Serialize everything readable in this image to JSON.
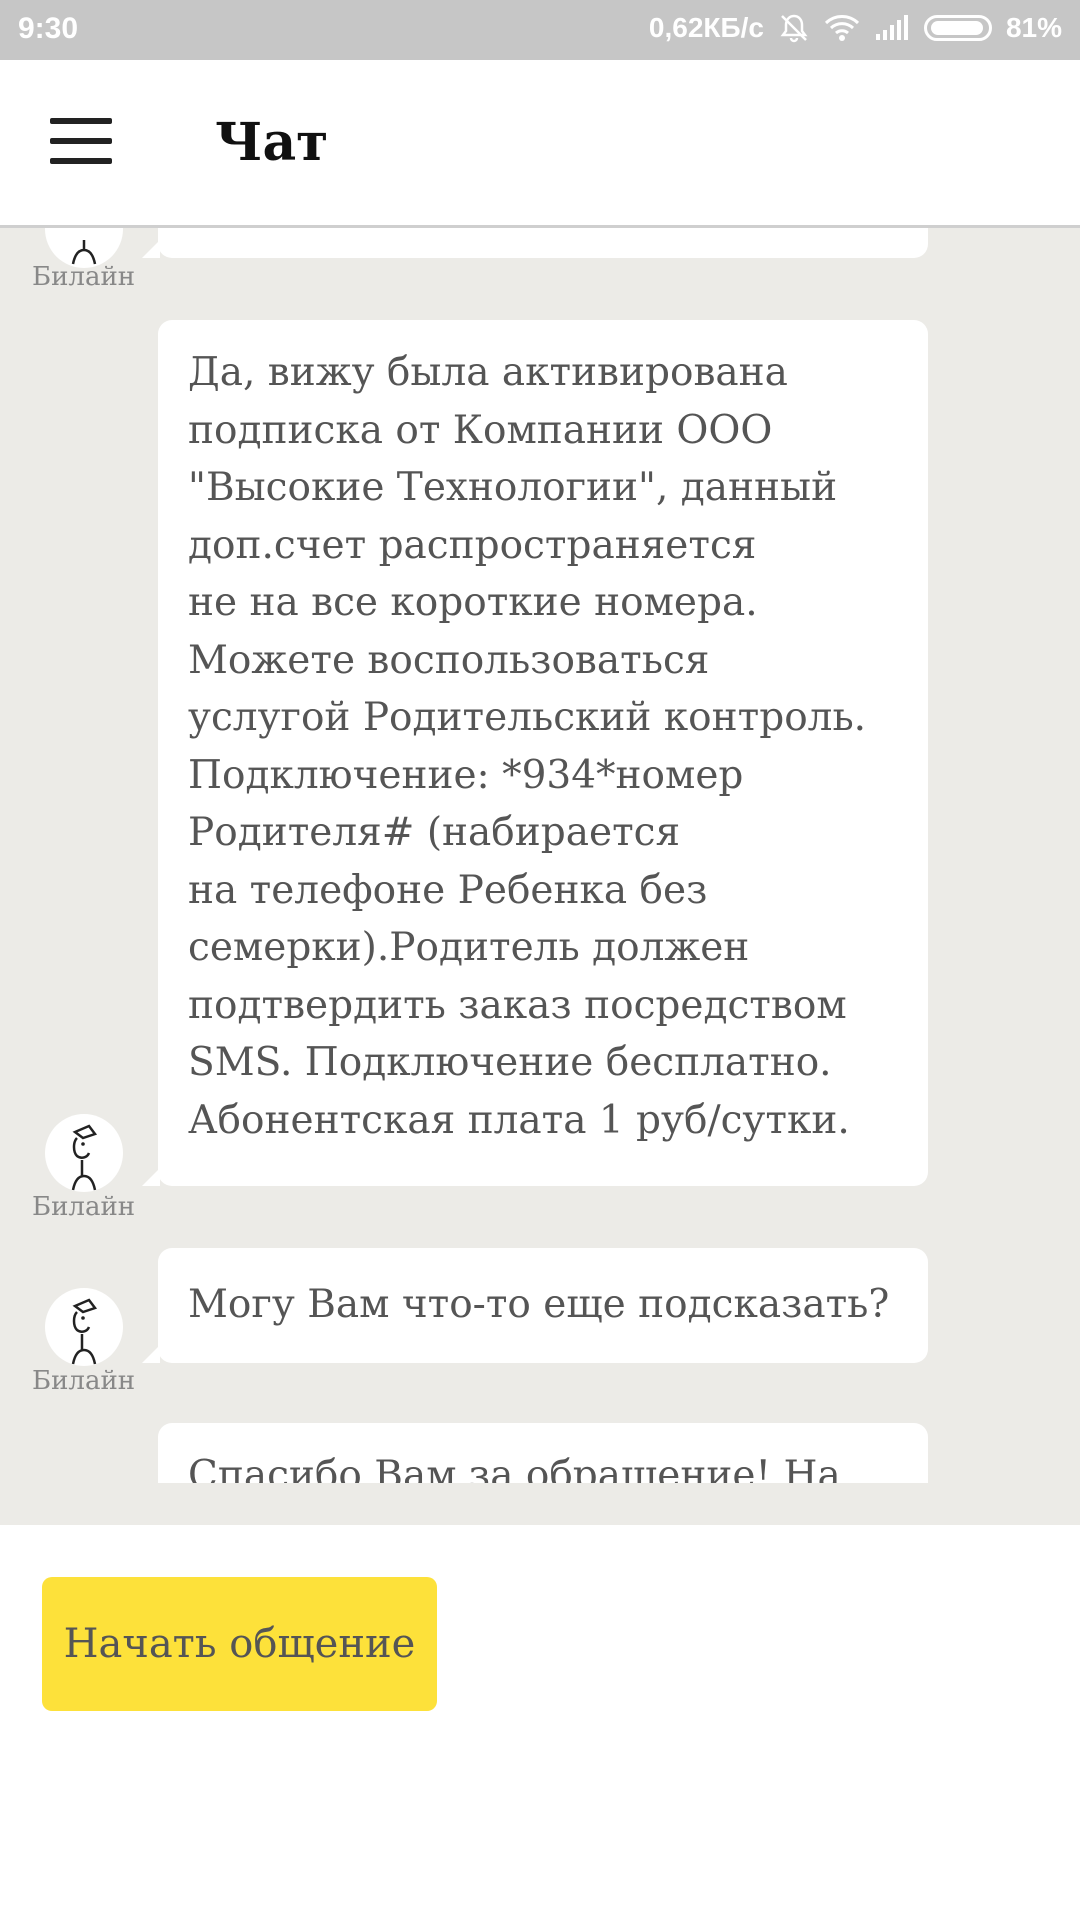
{
  "status_bar": {
    "time": "9:30",
    "speed": "0,62КБ/с",
    "battery": "81%",
    "icons": [
      "muted-bell-icon",
      "wifi-icon",
      "signal-icon",
      "battery-icon"
    ]
  },
  "app_bar": {
    "title": "Чат",
    "menu_icon": "hamburger-menu-icon"
  },
  "messages": [
    {
      "sender": "Билайн",
      "text": "Да, вижу была активирована\nподписка от Компании ООО\n\"Высокие Технологии\", данный\nдоп.счет распространяется\nне на все короткие номера.\nМожете воспользоваться\nуслугой Родительский контроль.\nПодключение: *934*номер\nРодителя# (набирается\nна телефоне Ребенка без\nсемерки).Родитель должен\nподтвердить заказ посредством\nSMS. Подключение бесплатно.\nАбонентская плата 1 руб/сутки."
    },
    {
      "sender": "Билайн",
      "text": "Могу Вам что-то еще подсказать?"
    },
    {
      "sender": "",
      "text": "Спасибо Вам за обращение! На"
    }
  ],
  "top_partial_sender": "Билайн",
  "start_button": {
    "label": "Начать общение"
  },
  "colors": {
    "accent": "#fde13a",
    "chat_bg": "#ecebe7",
    "status_bar": "#c6c6c6"
  }
}
